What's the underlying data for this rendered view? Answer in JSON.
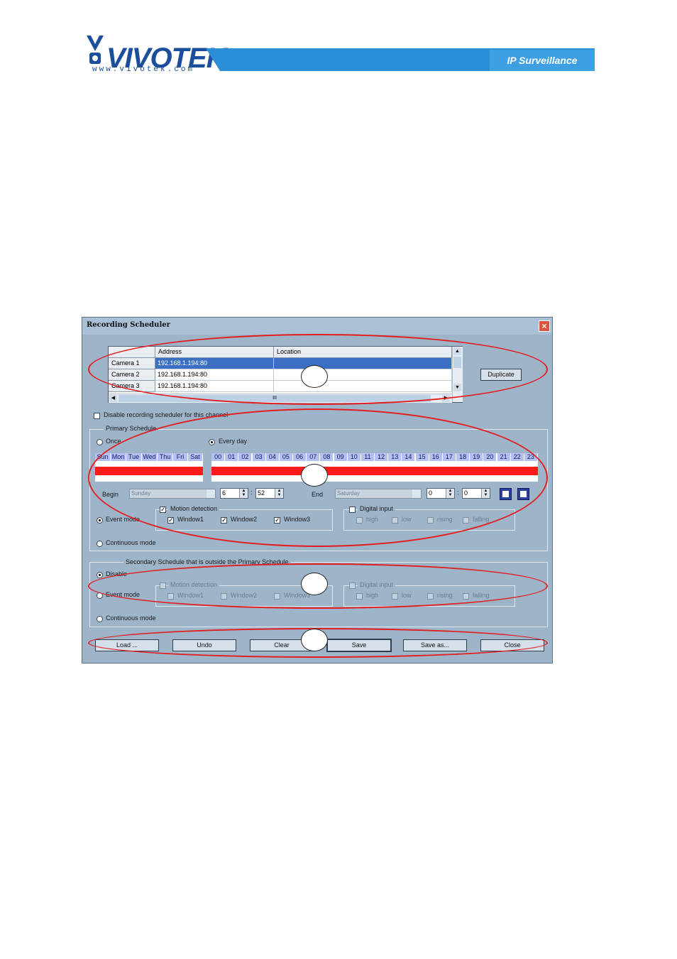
{
  "header": {
    "logo_text": "VIVOTEK",
    "logo_url": "www.vivotek.com",
    "banner_label": "IP Surveillance"
  },
  "window": {
    "title": "Recording Scheduler",
    "close_glyph": "×"
  },
  "camera_table": {
    "columns": [
      "",
      "Address",
      "Location"
    ],
    "rows": [
      {
        "camera": "Camera 1",
        "address": "192.168.1.194:80",
        "location": ""
      },
      {
        "camera": "Camera 2",
        "address": "192.168.1.194:80",
        "location": ""
      },
      {
        "camera": "Camera 3",
        "address": "192.168.1.194:80",
        "location": ""
      }
    ],
    "scroll_grip": "III"
  },
  "duplicate_label": "Duplicate",
  "disable_channel_label": "Disable recording scheduler for this channel",
  "primary": {
    "legend": "Primary Schedule",
    "once_label": "Once",
    "everyday_label": "Every day",
    "days": [
      "Sun",
      "Mon",
      "Tue",
      "Wed",
      "Thu",
      "Fri",
      "Sat"
    ],
    "hours": [
      "00",
      "01",
      "02",
      "03",
      "04",
      "05",
      "06",
      "07",
      "08",
      "09",
      "10",
      "11",
      "12",
      "13",
      "14",
      "15",
      "16",
      "17",
      "18",
      "19",
      "20",
      "21",
      "22",
      "23"
    ],
    "begin_label": "Begin",
    "begin_day": "Sunday",
    "begin_hour": "6",
    "begin_minute": "52",
    "end_label": "End",
    "end_day": "Saturday",
    "end_hour": "0",
    "end_minute": "0",
    "time_sep": ":",
    "event_mode_label": "Event mode",
    "continuous_mode_label": "Continuous mode",
    "motion_label": "Motion detection",
    "windows": [
      "Window1",
      "Window2",
      "Window3"
    ],
    "digital_label": "Digital input",
    "digital_options": [
      "high",
      "low",
      "rising",
      "falling"
    ]
  },
  "secondary": {
    "legend": "Secondary Schedule that is outside the Primary Schedule",
    "disable_label": "Disable",
    "event_mode_label": "Event mode",
    "continuous_mode_label": "Continuous mode",
    "motion_label": "Motion detection",
    "windows": [
      "Window1",
      "Window2",
      "Window3"
    ],
    "digital_label": "Digital input",
    "digital_options": [
      "high",
      "low",
      "rising",
      "falling"
    ]
  },
  "buttons": [
    "Load ...",
    "Undo",
    "Clear",
    "Save",
    "Save as...",
    "Close"
  ],
  "colors": {
    "window_bg": "#9db4c9",
    "schedule_bar": "#ff1a1a",
    "annotation": "#e31d1d",
    "header_blue": "#2a8fd6"
  }
}
